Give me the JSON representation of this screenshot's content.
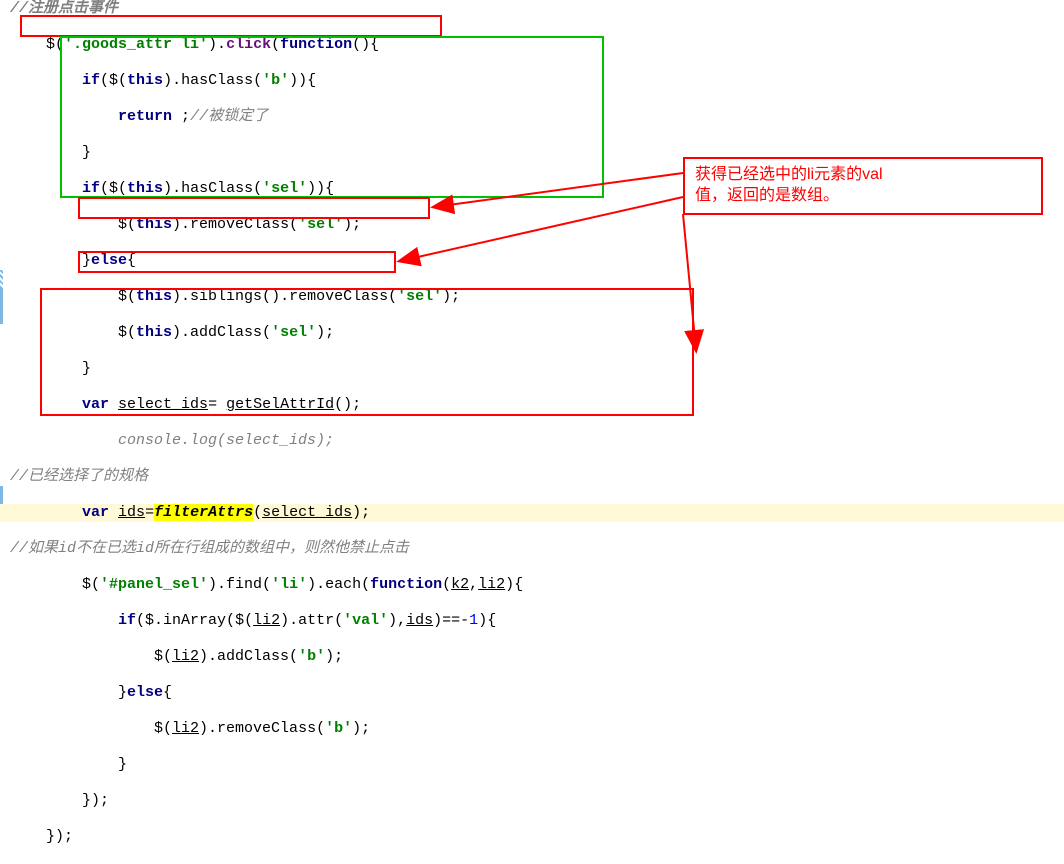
{
  "comments": {
    "register_click": "//注册点击事件",
    "locked": "//被锁定了",
    "selected_spec": "//已经选择了的规格",
    "not_in_array": "//如果id不在已选id所在行组成的数组中，则然他禁止点击"
  },
  "code": {
    "l1": "    $('.goods_attr li').click(function(){",
    "l2_a": "        if($(this).hasClass('b')){",
    "l3_a": "            return ;",
    "l4": "        }",
    "l5": "        if($(this).hasClass('sel')){",
    "l6": "            $(this).removeClass('sel');",
    "l7": "        }else{",
    "l8": "            $(this).siblings().removeClass('sel');",
    "l9": "            $(this).addClass('sel');",
    "l10": "        }",
    "l11": "        var select_ids= getSelAttrId();",
    "l12": "            console.log(select_ids);",
    "l13": "        var ids=filterAttrs(select_ids);",
    "l14": "        $('#panel_sel').find('li').each(function(k2,li2){",
    "l15": "            if($.inArray($(li2).attr('val'),ids)==-1){",
    "l16": "                $(li2).addClass('b');",
    "l17": "            }else{",
    "l18": "                $(li2).removeClass('b');",
    "l19": "            }",
    "l20": "        });",
    "l21": "    });"
  },
  "callout": {
    "text_line1": "获得已经选中的li元素的val",
    "text_line2": "值，返回的是数组。"
  }
}
